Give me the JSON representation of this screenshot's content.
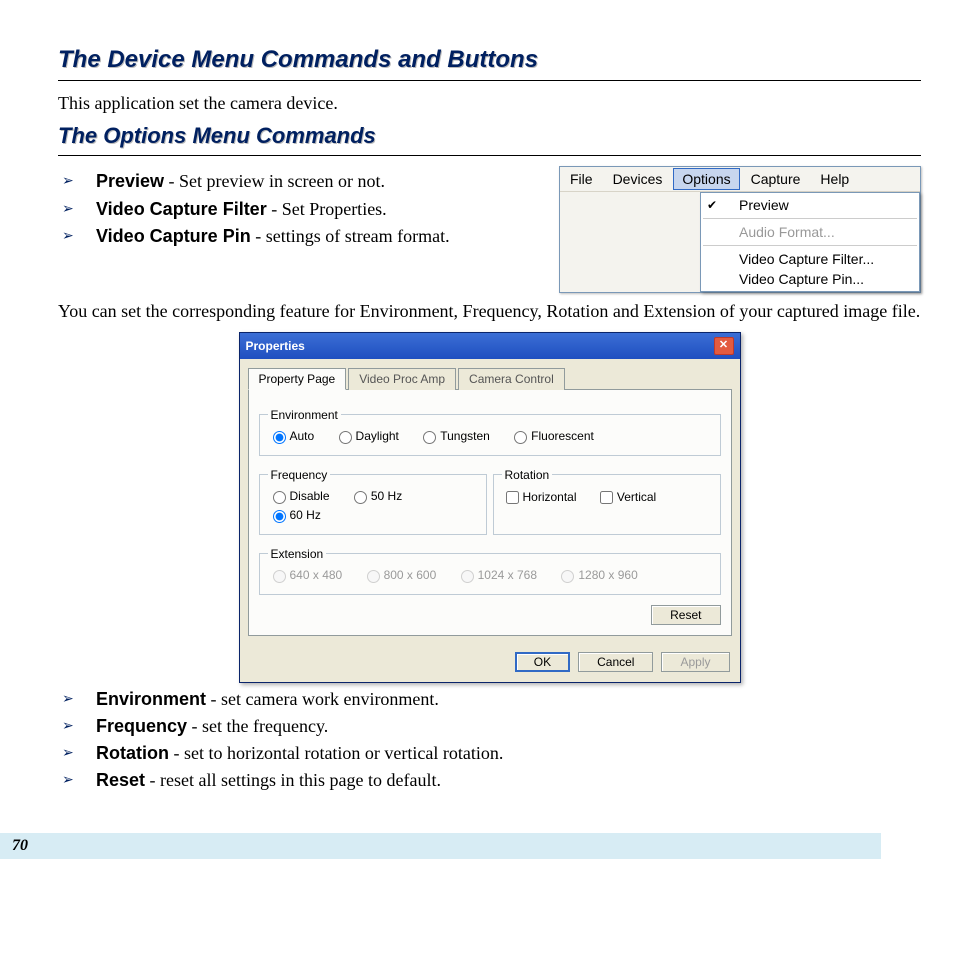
{
  "section1_title": "The Device Menu Commands and Buttons",
  "section1_text": "This application set the camera device.",
  "section2_title": "The Options Menu Commands",
  "bullets_top": [
    {
      "term": "Preview",
      "desc": " - Set preview in screen or not."
    },
    {
      "term": "Video Capture Filter",
      "desc": " - Set Properties."
    },
    {
      "term": "Video Capture Pin",
      "desc": " - settings of stream format."
    }
  ],
  "menubar": {
    "items": [
      "File",
      "Devices",
      "Options",
      "Capture",
      "Help"
    ],
    "active": "Options"
  },
  "dropdown": {
    "preview": "Preview",
    "audio_format": "Audio Format...",
    "vcf": "Video Capture Filter...",
    "vcp": "Video Capture Pin..."
  },
  "mid_para": "You can set the corresponding feature for Environment, Frequency, Rotation and Extension of your captured image file.",
  "props": {
    "title": "Properties",
    "tabs": [
      "Property Page",
      "Video Proc Amp",
      "Camera Control"
    ],
    "environment": {
      "legend": "Environment",
      "items": [
        "Auto",
        "Daylight",
        "Tungsten",
        "Fluorescent"
      ],
      "selected": "Auto"
    },
    "frequency": {
      "legend": "Frequency",
      "items": [
        "Disable",
        "50 Hz",
        "60 Hz"
      ],
      "selected": "60 Hz"
    },
    "rotation": {
      "legend": "Rotation",
      "horizontal": "Horizontal",
      "vertical": "Vertical"
    },
    "extension": {
      "legend": "Extension",
      "items": [
        "640 x 480",
        "800 x 600",
        "1024 x 768",
        "1280 x 960"
      ]
    },
    "reset": "Reset",
    "ok": "OK",
    "cancel": "Cancel",
    "apply": "Apply"
  },
  "bullets_bottom": [
    {
      "term": "Environment",
      "desc": " - set camera work environment."
    },
    {
      "term": "Frequency",
      "desc": " - set the frequency."
    },
    {
      "term": "Rotation",
      "desc": " - set to horizontal rotation or vertical rotation."
    },
    {
      "term": "Reset",
      "desc": " - reset all settings in this page to default."
    }
  ],
  "page_number": "70"
}
